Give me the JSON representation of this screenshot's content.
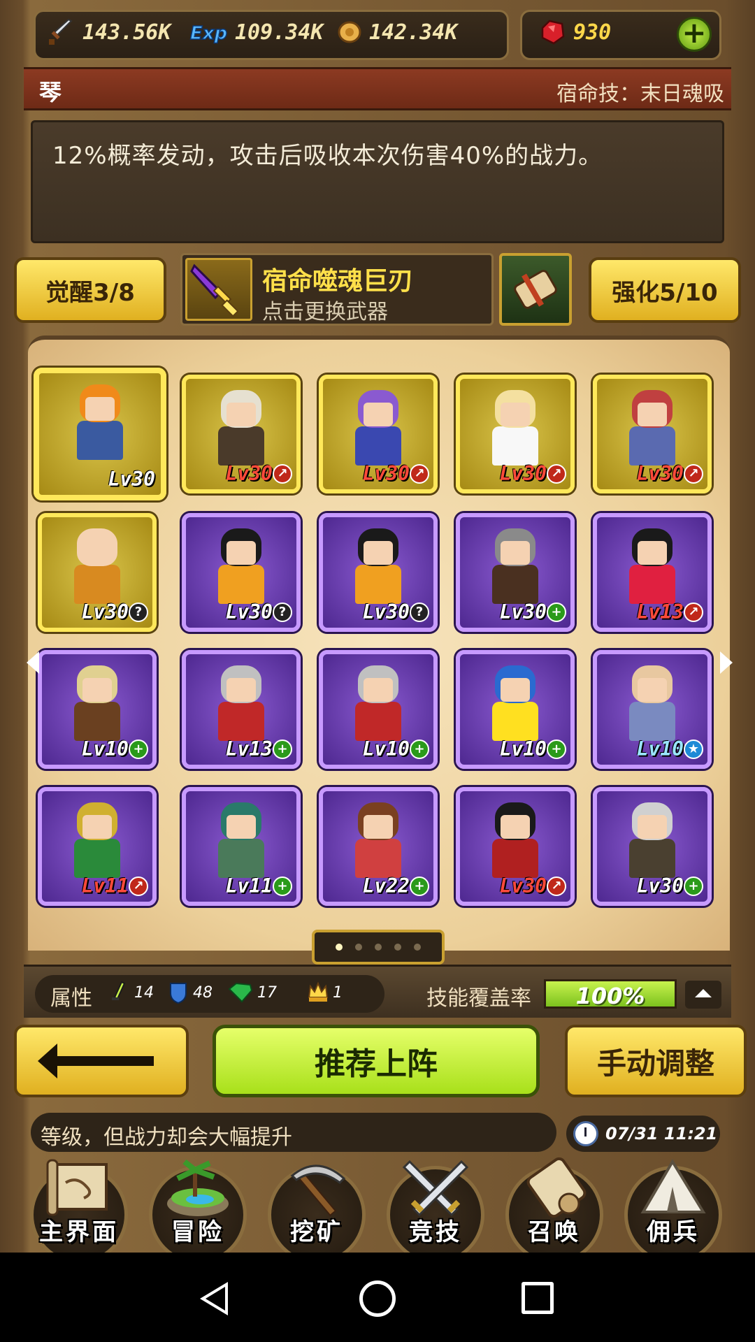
{
  "currency": {
    "attack": "143.56K",
    "exp": "109.34K",
    "gold": "142.34K",
    "gems": "930"
  },
  "header": {
    "hero_name": "琴",
    "fate_skill": "宿命技：末日魂吸"
  },
  "description": "12%概率发动，攻击后吸收本次伤害40%的战力。",
  "weapon": {
    "awaken_label": "觉醒3/8",
    "name": "宿命噬魂巨刃",
    "hint": "点击更换武器",
    "strengthen_label": "强化5/10"
  },
  "heroes": [
    {
      "level": "Lv30",
      "frame": "gold",
      "badge": "",
      "level_color": "white",
      "hair": "#f08a1a",
      "outfit": "#3a5aa0"
    },
    {
      "level": "Lv30",
      "frame": "gold",
      "badge": "arrow",
      "level_color": "red",
      "hair": "#e6e0d0",
      "outfit": "#4a3a2a"
    },
    {
      "level": "Lv30",
      "frame": "gold",
      "badge": "arrow",
      "level_color": "red",
      "hair": "#8a5ad0",
      "outfit": "#3a48b0"
    },
    {
      "level": "Lv30",
      "frame": "gold",
      "badge": "arrow",
      "level_color": "red",
      "hair": "#f4e0a0",
      "outfit": "#f8f8f8"
    },
    {
      "level": "Lv30",
      "frame": "gold",
      "badge": "arrow",
      "level_color": "red",
      "hair": "#c04040",
      "outfit": "#5a6ab0"
    },
    {
      "level": "Lv30",
      "frame": "gold",
      "badge": "q",
      "level_color": "white",
      "hair": "#f5d2b2",
      "outfit": "#d88a20"
    },
    {
      "level": "Lv30",
      "frame": "purple",
      "badge": "q",
      "level_color": "white",
      "hair": "#1a1a1a",
      "outfit": "#f0a020"
    },
    {
      "level": "Lv30",
      "frame": "purple",
      "badge": "q",
      "level_color": "white",
      "hair": "#1a1a1a",
      "outfit": "#f0a020"
    },
    {
      "level": "Lv30",
      "frame": "purple",
      "badge": "plus",
      "level_color": "white",
      "hair": "#8a8a8a",
      "outfit": "#4a3020"
    },
    {
      "level": "Lv13",
      "frame": "purple",
      "badge": "arrow",
      "level_color": "red",
      "hair": "#1a1a1a",
      "outfit": "#e02040"
    },
    {
      "level": "Lv10",
      "frame": "purple",
      "badge": "plus",
      "level_color": "white",
      "hair": "#e0d090",
      "outfit": "#6a4020"
    },
    {
      "level": "Lv13",
      "frame": "purple",
      "badge": "plus",
      "level_color": "white",
      "hair": "#c0c0c0",
      "outfit": "#c02828"
    },
    {
      "level": "Lv10",
      "frame": "purple",
      "badge": "plus",
      "level_color": "white",
      "hair": "#c0c0c0",
      "outfit": "#c02828"
    },
    {
      "level": "Lv10",
      "frame": "purple",
      "badge": "plus",
      "level_color": "white",
      "hair": "#2a6ad0",
      "outfit": "#ffe020"
    },
    {
      "level": "Lv10",
      "frame": "purple",
      "badge": "star",
      "level_color": "cyan",
      "hair": "#e8c8a0",
      "outfit": "#7a8ac0"
    },
    {
      "level": "Lv11",
      "frame": "purple",
      "badge": "arrow",
      "level_color": "red",
      "hair": "#d0b030",
      "outfit": "#2a8a3a"
    },
    {
      "level": "Lv11",
      "frame": "purple",
      "badge": "plus",
      "level_color": "white",
      "hair": "#2a7a6a",
      "outfit": "#4a7a5a"
    },
    {
      "level": "Lv22",
      "frame": "purple",
      "badge": "plus",
      "level_color": "white",
      "hair": "#7a4020",
      "outfit": "#d04040"
    },
    {
      "level": "Lv30",
      "frame": "purple",
      "badge": "arrow",
      "level_color": "red",
      "hair": "#1a1a1a",
      "outfit": "#b02020"
    },
    {
      "level": "Lv30",
      "frame": "purple",
      "badge": "plus",
      "level_color": "white",
      "hair": "#d0d0d0",
      "outfit": "#4a4030"
    }
  ],
  "pager": {
    "pages": 5,
    "current": 1
  },
  "attributes": {
    "label": "属性",
    "sword": "14",
    "shield": "48",
    "gem": "17",
    "crown": "1"
  },
  "coverage": {
    "label": "技能覆盖率",
    "value_text": "100%",
    "fraction": 1.0
  },
  "actions": {
    "recommend": "推荐上阵",
    "manual": "手动调整"
  },
  "ticker": "等级，但战力却会大幅提升",
  "clock": "07/31 11:21",
  "nav": [
    {
      "label": "主界面",
      "icon": "map-scroll-icon"
    },
    {
      "label": "冒险",
      "icon": "island-icon"
    },
    {
      "label": "挖矿",
      "icon": "pickaxe-icon"
    },
    {
      "label": "竞技",
      "icon": "crossed-swords-icon"
    },
    {
      "label": "召唤",
      "icon": "summon-scroll-icon"
    },
    {
      "label": "佣兵",
      "icon": "tent-icon"
    }
  ],
  "colors": {
    "gold_frame": "#ffe85a",
    "purple_frame": "#c79aff",
    "accent_green": "#a8e01a",
    "header_red": "#8c3a22"
  }
}
